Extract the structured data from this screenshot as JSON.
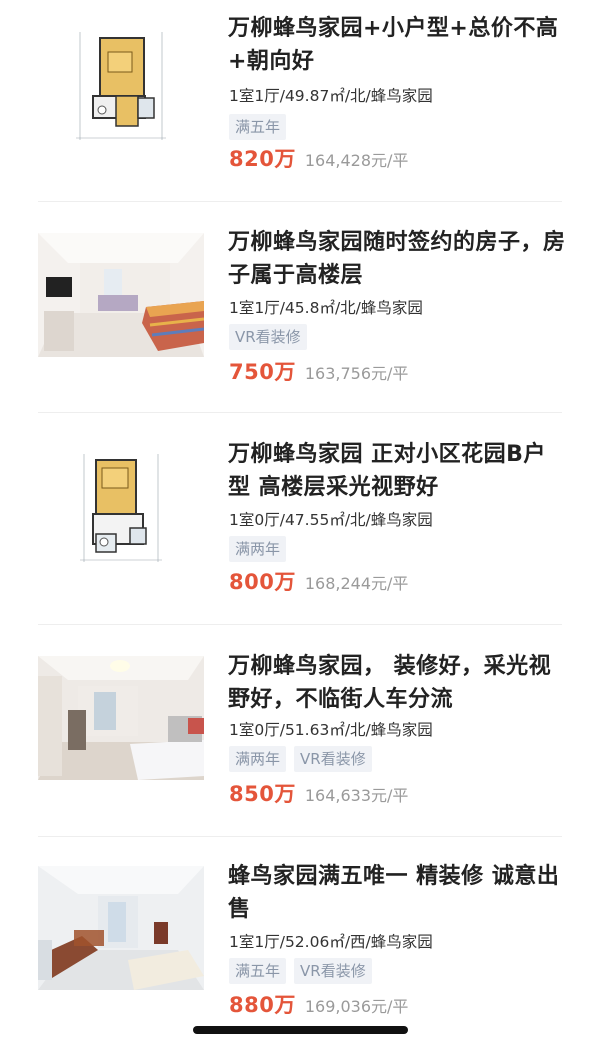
{
  "listings": [
    {
      "thumb_kind": "floorplan",
      "title": "万柳蜂鸟家园+小户型+总价不高+朝向好",
      "meta": "1室1厅/49.87㎡/北/蜂鸟家园",
      "tags": [
        "满五年"
      ],
      "price": "820万",
      "unit_price": "164,428元/平"
    },
    {
      "thumb_kind": "photo-living",
      "title": "万柳蜂鸟家园随时签约的房子，房子属于高楼层",
      "meta": "1室1厅/45.8㎡/北/蜂鸟家园",
      "tags": [
        "VR看装修"
      ],
      "price": "750万",
      "unit_price": "163,756元/平"
    },
    {
      "thumb_kind": "floorplan",
      "title": "万柳蜂鸟家园 正对小区花园B户型 高楼层采光视野好",
      "meta": "1室0厅/47.55㎡/北/蜂鸟家园",
      "tags": [
        "满两年"
      ],
      "price": "800万",
      "unit_price": "168,244元/平"
    },
    {
      "thumb_kind": "photo-bedroom",
      "title": "万柳蜂鸟家园， 装修好，采光视野好，不临街人车分流",
      "meta": "1室0厅/51.63㎡/北/蜂鸟家园",
      "tags": [
        "满两年",
        "VR看装修"
      ],
      "price": "850万",
      "unit_price": "164,633元/平"
    },
    {
      "thumb_kind": "photo-hall",
      "title": "蜂鸟家园满五唯一 精装修 诚意出售",
      "meta": "1室1厅/52.06㎡/西/蜂鸟家园",
      "tags": [
        "满五年",
        "VR看装修"
      ],
      "price": "880万",
      "unit_price": "169,036元/平"
    }
  ],
  "colors": {
    "price": "#e4553a",
    "tag_bg": "#f0f2f6",
    "tag_text": "#8a96a8",
    "unit_price": "#9a9a9a"
  },
  "icons": {
    "floorplan": "floorplan-thumbnail",
    "photo": "room-photo-thumbnail"
  }
}
